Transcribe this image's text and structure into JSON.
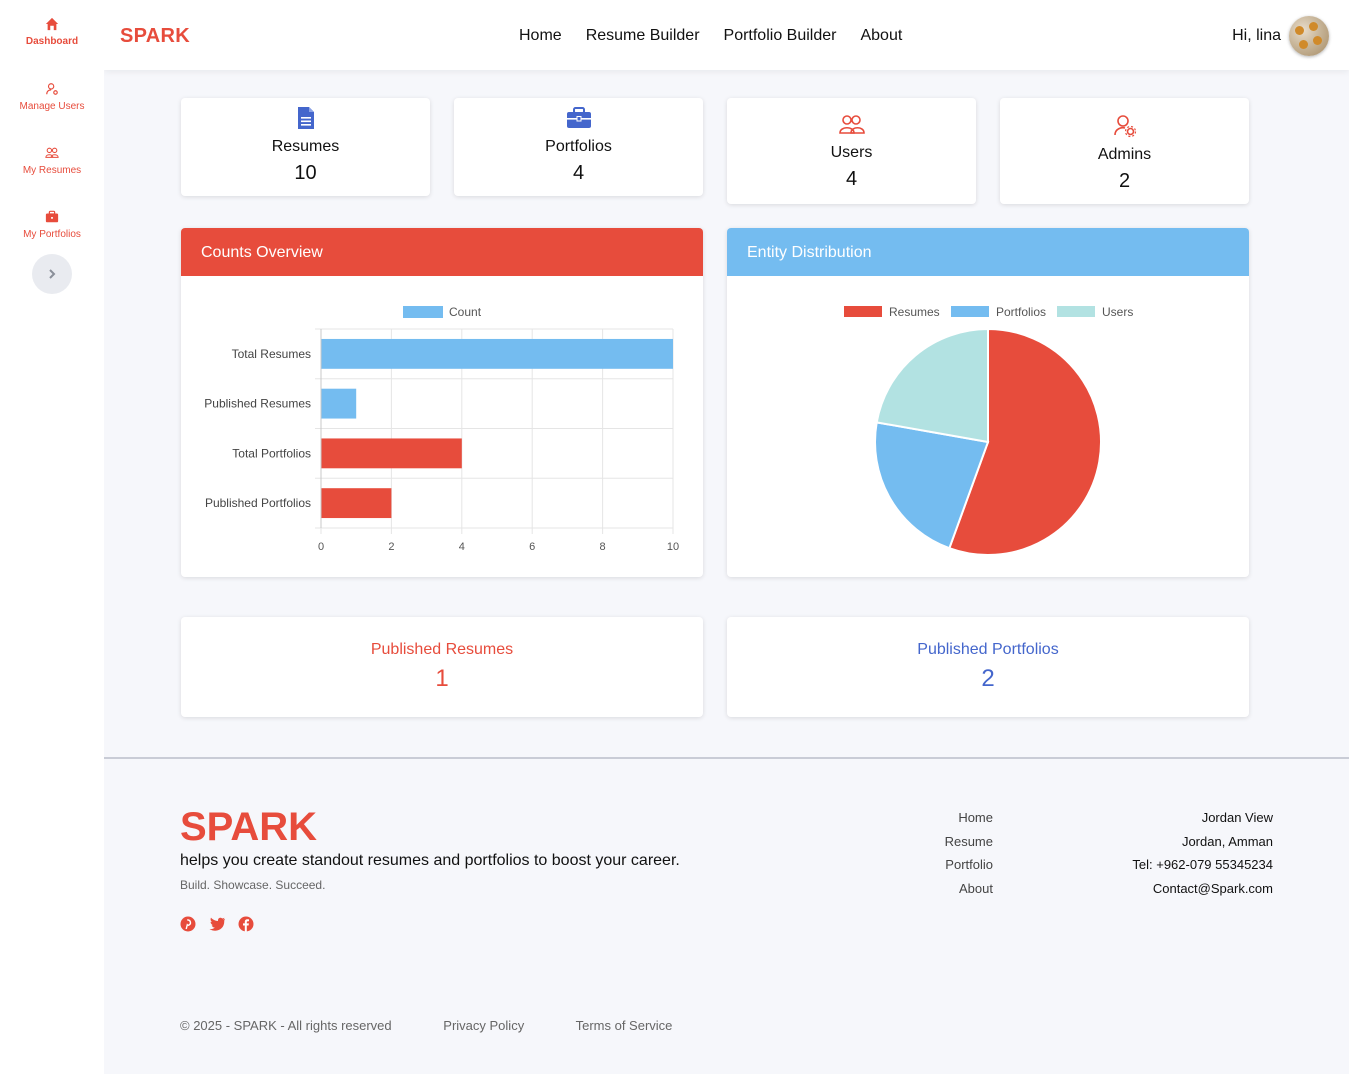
{
  "sidebar": {
    "items": [
      {
        "label": "Dashboard",
        "icon": "home-icon"
      },
      {
        "label": "Manage Users",
        "icon": "user-gear-icon"
      },
      {
        "label": "My Resumes",
        "icon": "users-icon"
      },
      {
        "label": "My Portfolios",
        "icon": "briefcase-icon"
      }
    ],
    "toggle_icon": "chevron-right-icon"
  },
  "header": {
    "brand": "SPARK",
    "nav": [
      "Home",
      "Resume Builder",
      "Portfolio Builder",
      "About"
    ],
    "greeting": "Hi, lina"
  },
  "stats": [
    {
      "label": "Resumes",
      "value": "10",
      "icon": "document-icon"
    },
    {
      "label": "Portfolios",
      "value": "4",
      "icon": "briefcase-icon"
    },
    {
      "label": "Users",
      "value": "4",
      "icon": "users-icon"
    },
    {
      "label": "Admins",
      "value": "2",
      "icon": "user-gear-icon"
    }
  ],
  "panels": {
    "counts_title": "Counts Overview",
    "entity_title": "Entity Distribution"
  },
  "colors": {
    "brand": "#e74c3c",
    "blue": "#74bcf0",
    "teal": "#b2e2e2",
    "accent_blue": "#4466cc"
  },
  "chart_data": [
    {
      "type": "bar",
      "orientation": "horizontal",
      "categories": [
        "Total Resumes",
        "Published Resumes",
        "Total Portfolios",
        "Published Portfolios"
      ],
      "series": [
        {
          "name": "Count",
          "values": [
            10,
            1,
            4,
            2
          ]
        }
      ],
      "bar_colors": [
        "#74bcf0",
        "#74bcf0",
        "#e74c3c",
        "#e74c3c"
      ],
      "xticks": [
        "0",
        "2",
        "4",
        "6",
        "8",
        "10"
      ],
      "xlim": [
        0,
        10
      ],
      "grid": true,
      "legend": "top"
    },
    {
      "type": "pie",
      "labels": [
        "Resumes",
        "Portfolios",
        "Users"
      ],
      "values": [
        10,
        4,
        4
      ],
      "colors": [
        "#e74c3c",
        "#74bcf0",
        "#b2e2e2"
      ],
      "legend": "top"
    }
  ],
  "published": [
    {
      "label": "Published Resumes",
      "value": "1",
      "color": "#e74c3c"
    },
    {
      "label": "Published Portfolios",
      "value": "2",
      "color": "#4466cc"
    }
  ],
  "footer": {
    "brand": "SPARK",
    "tagline": "helps you create standout resumes and portfolios to boost your career.",
    "sub": "Build. Showcase. Succeed.",
    "social": [
      "pinterest-icon",
      "twitter-icon",
      "facebook-icon"
    ],
    "links": [
      "Home",
      "Resume",
      "Portfolio",
      "About"
    ],
    "contact": [
      "Jordan View",
      "Jordan, Amman",
      "Tel: +962-079 55345234",
      "Contact@Spark.com"
    ],
    "copyright": "© 2025 - SPARK - All rights reserved",
    "privacy": "Privacy Policy",
    "terms": "Terms of Service"
  }
}
